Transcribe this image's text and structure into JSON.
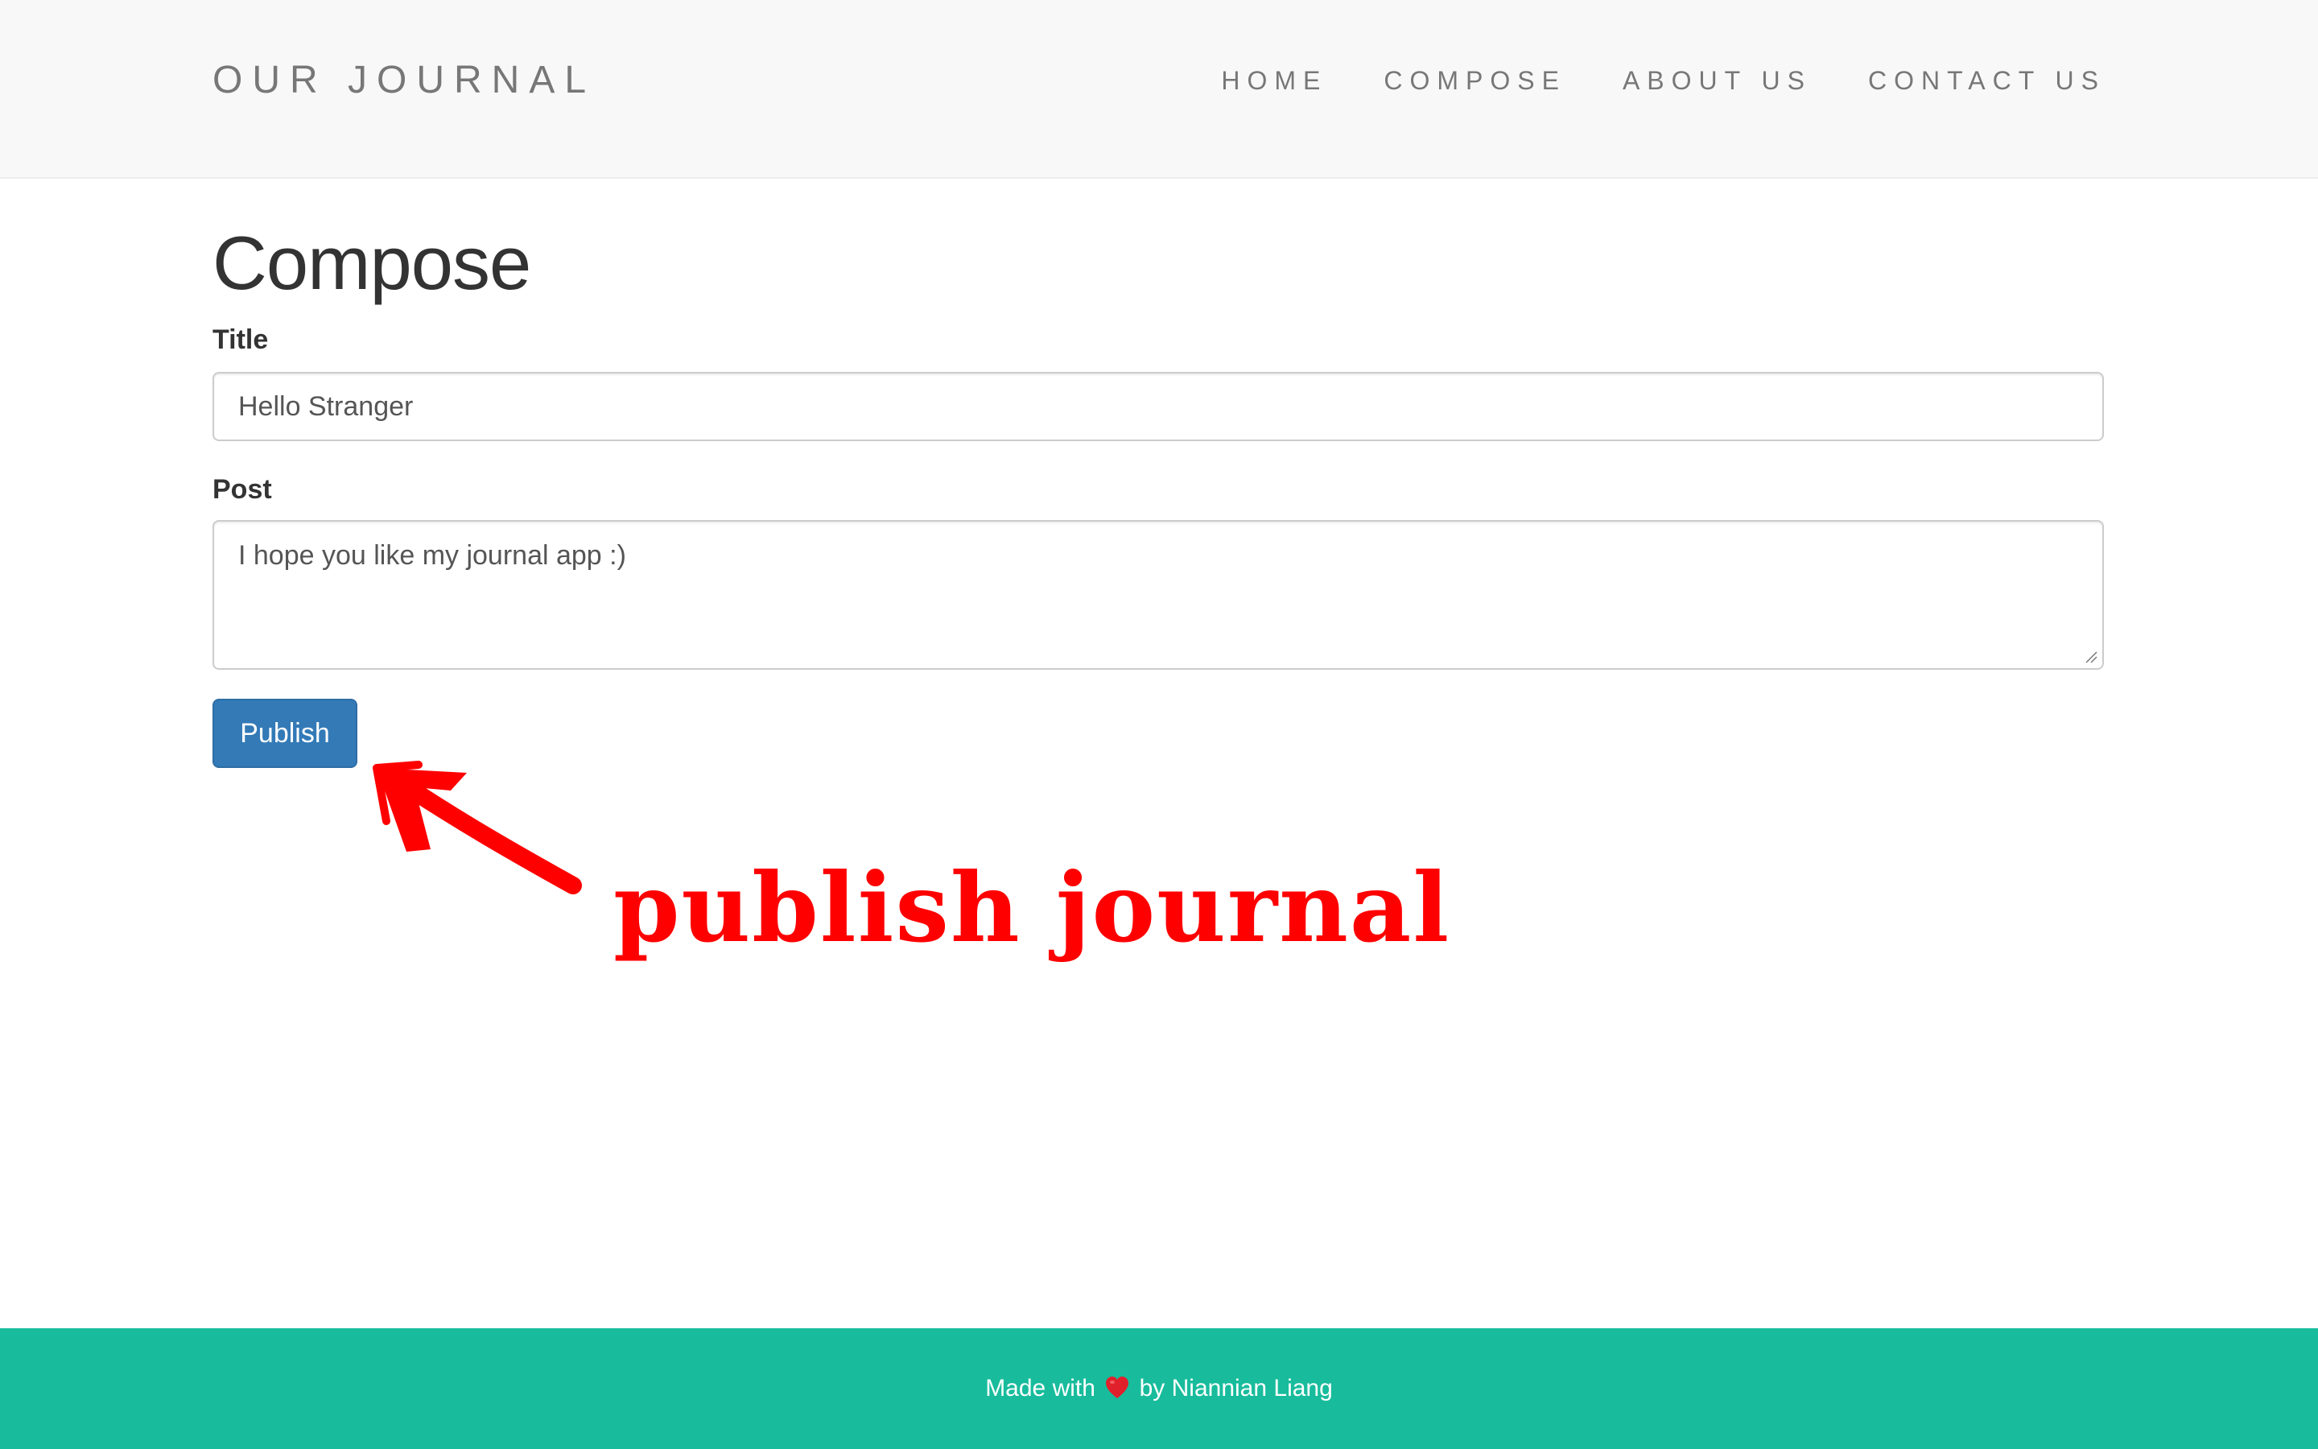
{
  "navbar": {
    "brand": "OUR JOURNAL",
    "items": [
      {
        "label": "HOME"
      },
      {
        "label": "COMPOSE"
      },
      {
        "label": "ABOUT US"
      },
      {
        "label": "CONTACT US"
      }
    ]
  },
  "main": {
    "heading": "Compose",
    "title_label": "Title",
    "title_value": "Hello Stranger",
    "post_label": "Post",
    "post_value": "I hope you like my journal app :)",
    "publish_label": "Publish"
  },
  "annotation": {
    "text": "publish journal",
    "color": "#ff0000"
  },
  "footer": {
    "prefix": "Made with",
    "heart_icon": "heart-icon",
    "suffix": "by Niannian Liang"
  },
  "colors": {
    "navbar_bg": "#f8f8f8",
    "primary_button": "#337ab7",
    "footer_bg": "#18bc9c"
  }
}
